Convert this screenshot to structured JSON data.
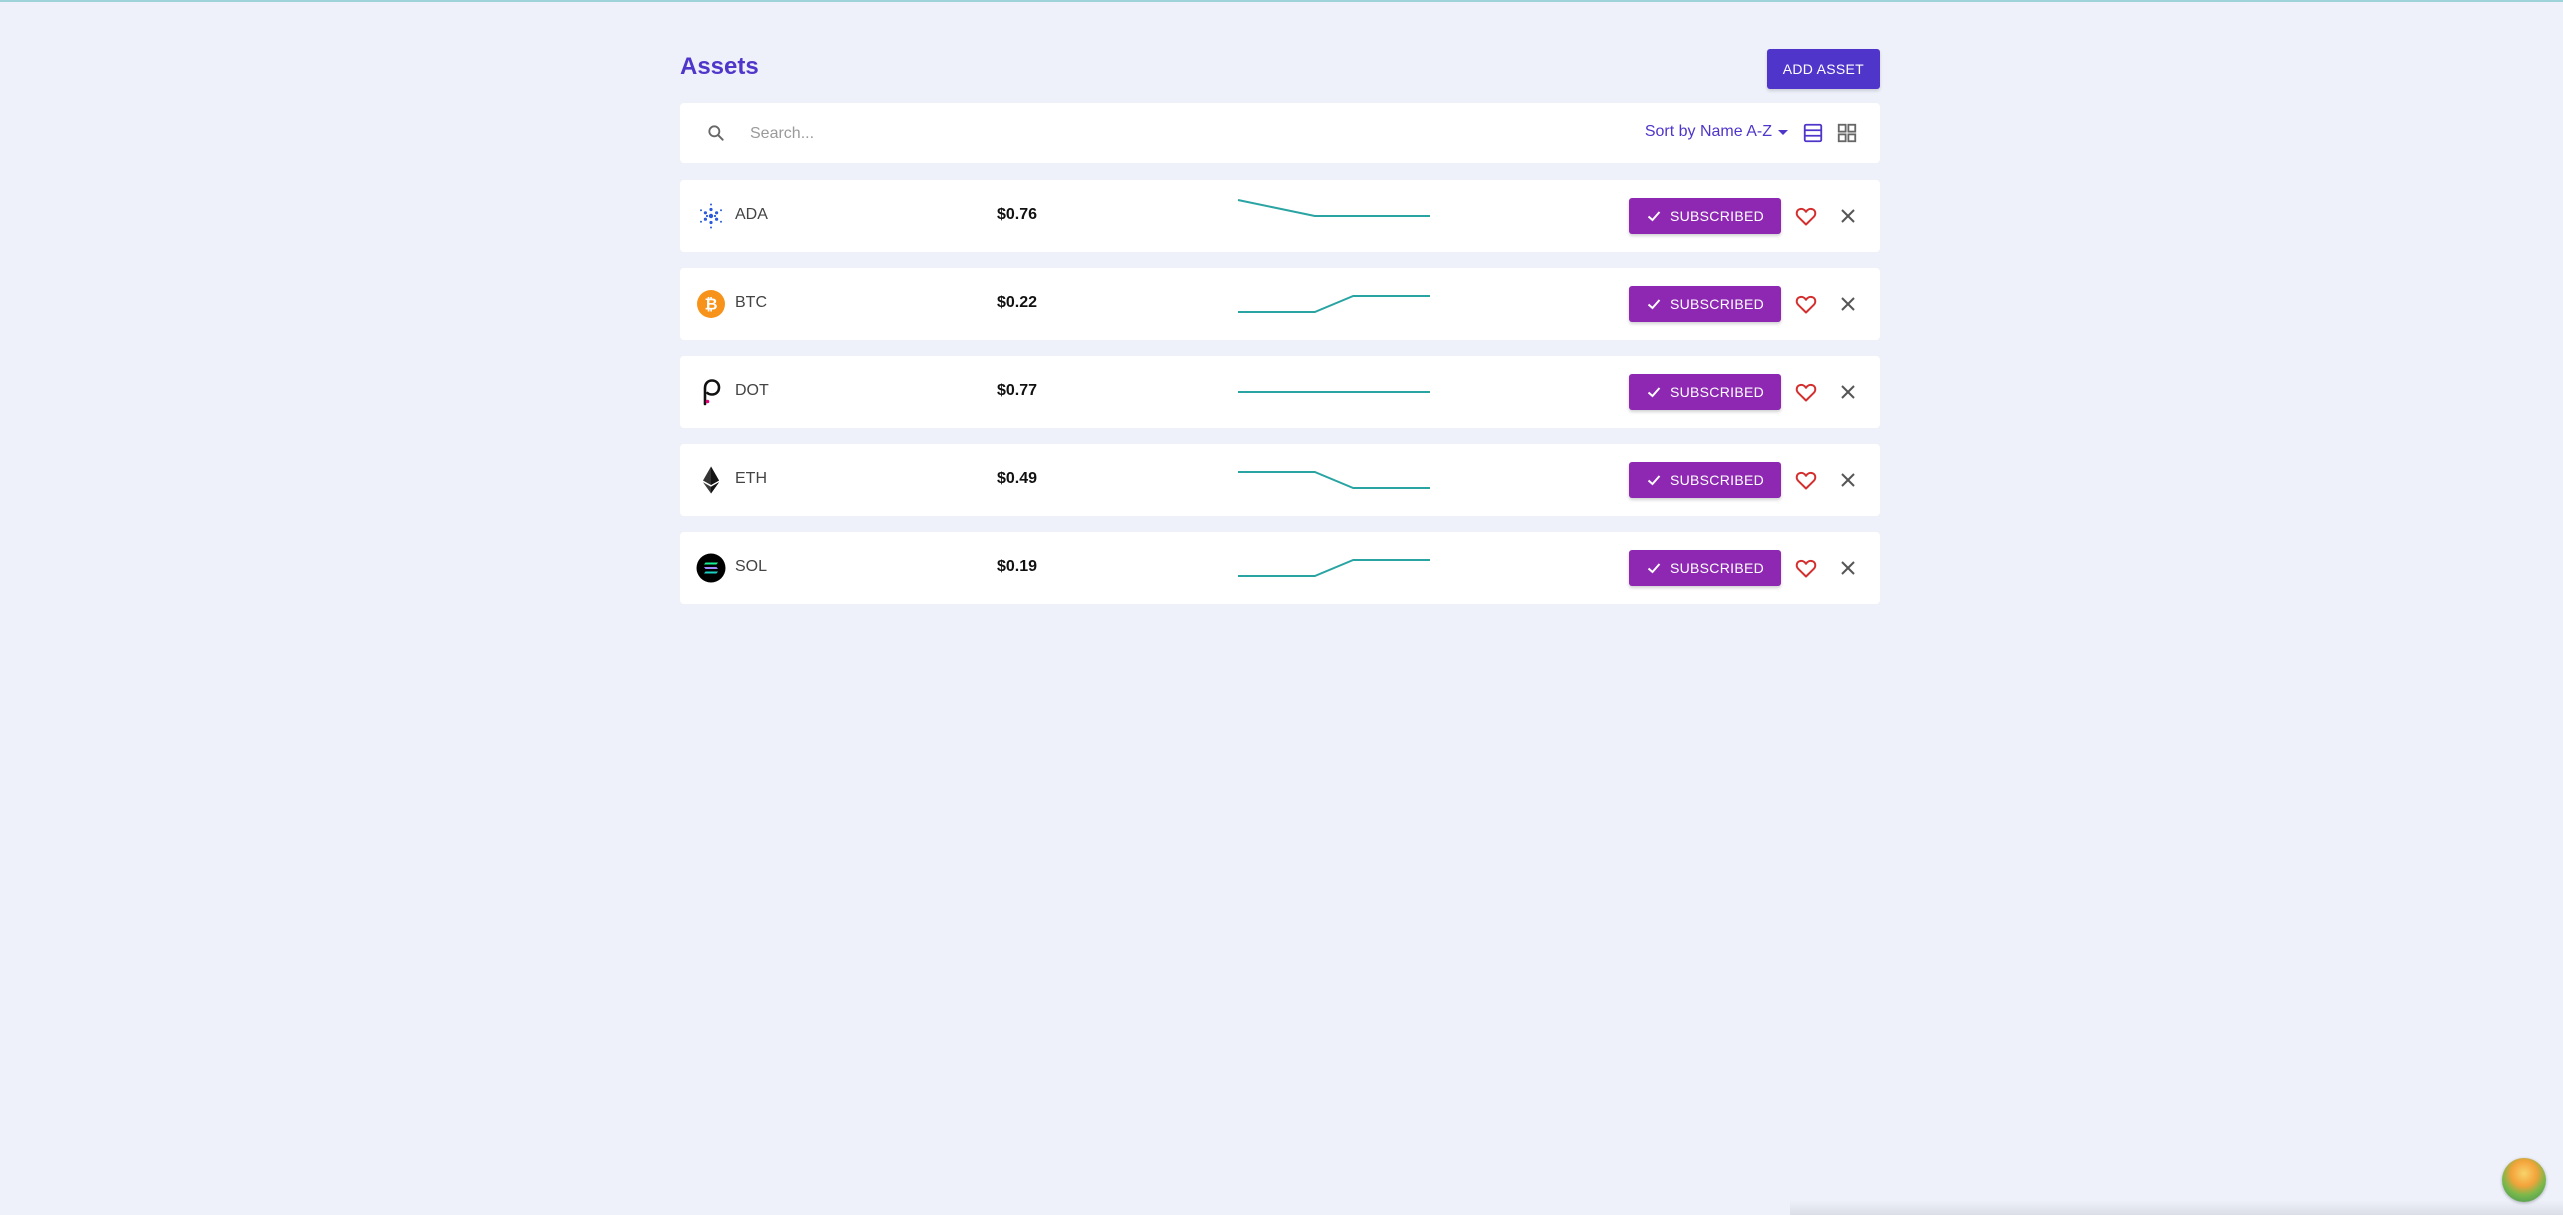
{
  "header": {
    "title": "Assets",
    "add_button_label": "ADD ASSET"
  },
  "toolbar": {
    "search_placeholder": "Search...",
    "sort_label": "Sort by Name A-Z",
    "icons": {
      "search": "search-icon",
      "list_view": "list-view-icon",
      "grid_view": "grid-view-icon"
    }
  },
  "assets": [
    {
      "symbol": "ADA",
      "price": "$0.76",
      "trend": [
        4,
        3,
        2,
        2,
        2,
        2
      ],
      "subscribed_label": "SUBSCRIBED"
    },
    {
      "symbol": "BTC",
      "price": "$0.22",
      "trend": [
        1,
        1,
        1,
        3,
        3,
        3
      ],
      "subscribed_label": "SUBSCRIBED"
    },
    {
      "symbol": "DOT",
      "price": "$0.77",
      "trend": [
        2,
        2,
        2,
        2,
        2,
        2
      ],
      "subscribed_label": "SUBSCRIBED"
    },
    {
      "symbol": "ETH",
      "price": "$0.49",
      "trend": [
        3,
        3,
        3,
        1,
        1,
        1
      ],
      "subscribed_label": "SUBSCRIBED"
    },
    {
      "symbol": "SOL",
      "price": "$0.19",
      "trend": [
        1,
        1,
        1,
        3,
        3,
        3
      ],
      "subscribed_label": "SUBSCRIBED"
    }
  ],
  "colors": {
    "accent": "#4f35c9",
    "subscribed": "#8e28b3",
    "sparkline": "#2aa3a3",
    "favorite": "#d32f2f",
    "background": "#eef1fa"
  }
}
